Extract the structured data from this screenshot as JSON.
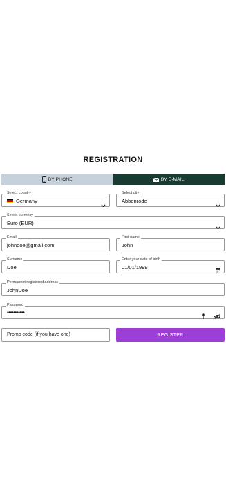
{
  "page": {
    "title": "REGISTRATION"
  },
  "tabs": [
    {
      "label": "BY PHONE",
      "icon": "phone-icon",
      "active": false
    },
    {
      "label": "BY E-MAIL",
      "icon": "mail-icon",
      "active": true
    }
  ],
  "form": {
    "country": {
      "label": "Select country",
      "value": "Germany"
    },
    "city": {
      "label": "Select city",
      "value": "Abbenrode"
    },
    "currency": {
      "label": "Select currency",
      "value": "Euro (EUR)"
    },
    "email": {
      "label": "Email",
      "value": "johndoe@gmail.com"
    },
    "first_name": {
      "label": "First name",
      "value": "John"
    },
    "surname": {
      "label": "Surname",
      "value": "Doe"
    },
    "dob": {
      "label": "Enter your date of birth",
      "value": "01/01/1999"
    },
    "address": {
      "label": "Permanent registered address",
      "value": "JohnDoe"
    },
    "password": {
      "label": "Password",
      "value": "•••••••••••"
    },
    "promo": {
      "placeholder": "Promo code (if you have one)"
    },
    "register_label": "REGISTER"
  },
  "colors": {
    "tab_inactive": "#c7d1dc",
    "tab_active": "#183a31",
    "register_button": "#9b3fd6"
  }
}
